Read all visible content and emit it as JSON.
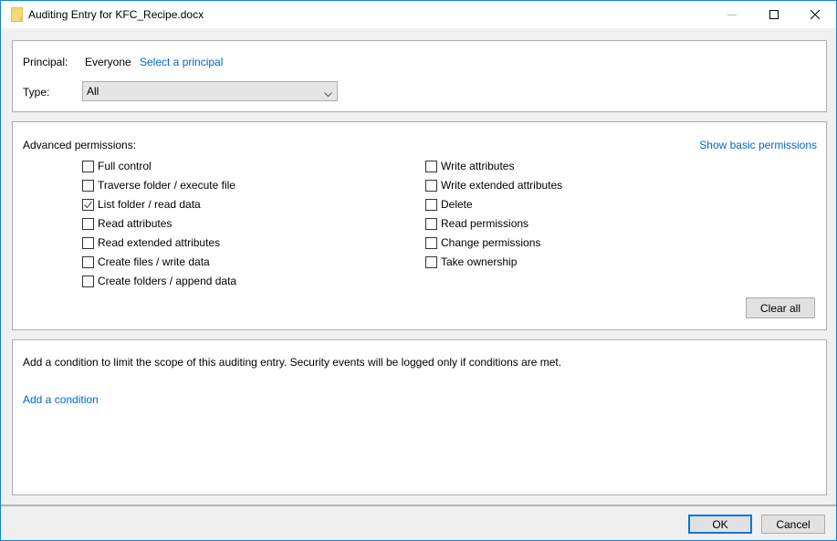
{
  "window": {
    "title": "Auditing Entry for KFC_Recipe.docx",
    "icon": "folder-icon",
    "controls": {
      "minimize": "minimize-icon",
      "maximize": "maximize-icon",
      "close": "close-icon"
    }
  },
  "principal": {
    "label": "Principal:",
    "value": "Everyone",
    "select_link": "Select a principal"
  },
  "type": {
    "label": "Type:",
    "selected": "All"
  },
  "permissions": {
    "label": "Advanced permissions:",
    "show_basic_link": "Show basic permissions",
    "left": [
      {
        "label": "Full control",
        "checked": false
      },
      {
        "label": "Traverse folder / execute file",
        "checked": false
      },
      {
        "label": "List folder / read data",
        "checked": true
      },
      {
        "label": "Read attributes",
        "checked": false
      },
      {
        "label": "Read extended attributes",
        "checked": false
      },
      {
        "label": "Create files / write data",
        "checked": false
      },
      {
        "label": "Create folders / append data",
        "checked": false
      }
    ],
    "right": [
      {
        "label": "Write attributes",
        "checked": false
      },
      {
        "label": "Write extended attributes",
        "checked": false
      },
      {
        "label": "Delete",
        "checked": false
      },
      {
        "label": "Read permissions",
        "checked": false
      },
      {
        "label": "Change permissions",
        "checked": false
      },
      {
        "label": "Take ownership",
        "checked": false
      }
    ],
    "clear_all": "Clear all"
  },
  "condition": {
    "description": "Add a condition to limit the scope of this auditing entry. Security events will be logged only if conditions are met.",
    "add_link": "Add a condition"
  },
  "footer": {
    "ok": "OK",
    "cancel": "Cancel"
  },
  "colors": {
    "accent": "#0078d7",
    "link": "#0066cc",
    "window_border": "#1883d7"
  }
}
